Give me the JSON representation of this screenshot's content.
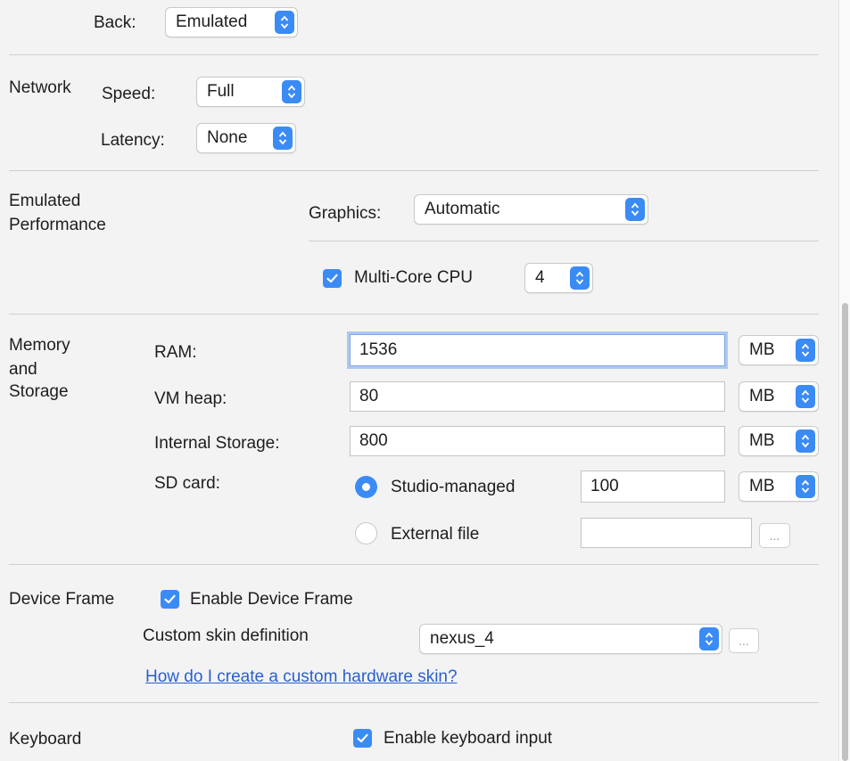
{
  "camera": {
    "back_label": "Back:",
    "back_value": "Emulated"
  },
  "network": {
    "section_label": "Network",
    "speed_label": "Speed:",
    "speed_value": "Full",
    "latency_label": "Latency:",
    "latency_value": "None"
  },
  "performance": {
    "section_label_line1": "Emulated",
    "section_label_line2": "Performance",
    "graphics_label": "Graphics:",
    "graphics_value": "Automatic",
    "multicore_label": "Multi-Core CPU",
    "multicore_checked": true,
    "multicore_value": "4"
  },
  "memory": {
    "section_label_line1": "Memory",
    "section_label_line2": "and",
    "section_label_line3": "Storage",
    "ram_label": "RAM:",
    "ram_value": "1536",
    "ram_unit": "MB",
    "vmheap_label": "VM heap:",
    "vmheap_value": "80",
    "vmheap_unit": "MB",
    "internal_label": "Internal Storage:",
    "internal_value": "800",
    "internal_unit": "MB",
    "sdcard_label": "SD card:",
    "studio_managed_label": "Studio-managed",
    "studio_managed_selected": true,
    "sdcard_value": "100",
    "sdcard_unit": "MB",
    "external_file_label": "External file",
    "external_file_value": "",
    "browse_label": "..."
  },
  "device_frame": {
    "section_label": "Device Frame",
    "enable_label": "Enable Device Frame",
    "enable_checked": true,
    "skin_label": "Custom skin definition",
    "skin_value": "nexus_4",
    "browse_label": "...",
    "help_link": "How do I create a custom hardware skin?"
  },
  "keyboard": {
    "section_label": "Keyboard",
    "enable_label": "Enable keyboard input",
    "enable_checked": true
  },
  "colors": {
    "accent": "#3b8bf5",
    "link": "#2a5fd0",
    "background": "#f3f3f3"
  }
}
